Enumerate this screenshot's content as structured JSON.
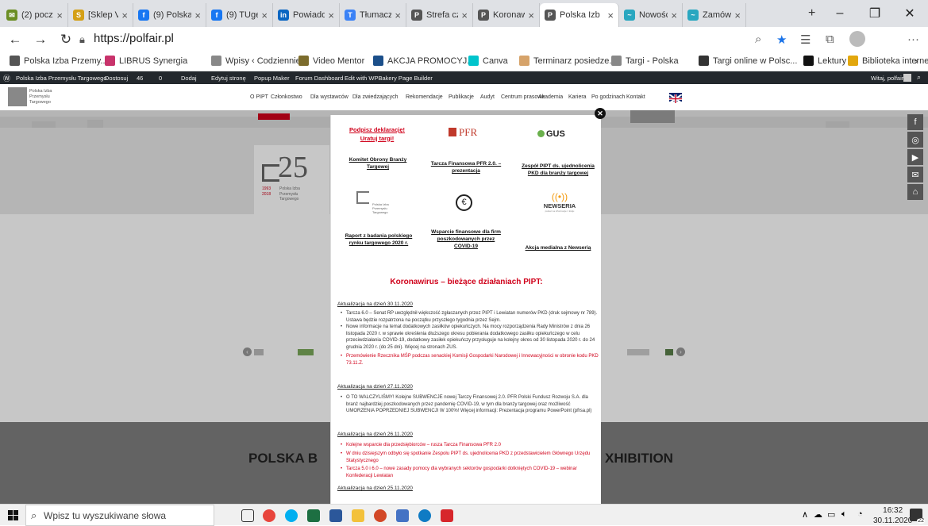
{
  "browser": {
    "tabs": [
      {
        "label": "(2) poczta",
        "color": "#6b8e23",
        "glyph": "✉"
      },
      {
        "label": "[Sklep Va",
        "color": "#d4a017",
        "glyph": "S"
      },
      {
        "label": "(9) Polska",
        "color": "#1877f2",
        "glyph": "f"
      },
      {
        "label": "(9) TUget",
        "color": "#1877f2",
        "glyph": "f"
      },
      {
        "label": "Powiadom",
        "color": "#0a66c2",
        "glyph": "in"
      },
      {
        "label": "Tłumacz G",
        "color": "#3b82f6",
        "glyph": "T"
      },
      {
        "label": "Strefa czł",
        "color": "#555555",
        "glyph": "P"
      },
      {
        "label": "Koronawi",
        "color": "#555555",
        "glyph": "P"
      },
      {
        "label": "Polska Izb",
        "color": "#555555",
        "glyph": "P"
      },
      {
        "label": "Nowości",
        "color": "#2aa7c0",
        "glyph": "~"
      },
      {
        "label": "Zamówie",
        "color": "#2aa7c0",
        "glyph": "~"
      }
    ],
    "new_tab": "+",
    "url": "https://polfair.pl",
    "bookmarks": [
      {
        "label": "Polska Izba Przemy...",
        "color": "#555555"
      },
      {
        "label": "LIBRUS Synergia",
        "color": "#c8336b"
      },
      {
        "label": "Wpisy ‹ Codziennie...",
        "color": "#888888"
      },
      {
        "label": "Video Mentor",
        "color": "#7c6c2c"
      },
      {
        "label": "AKCJA PROMOCYJ...",
        "color": "#1b4f8a"
      },
      {
        "label": "Canva",
        "color": "#00c4cc"
      },
      {
        "label": "Terminarz posiedze...",
        "color": "#d6a36a"
      },
      {
        "label": "Targi - Polska",
        "color": "#888888"
      },
      {
        "label": "Targi online w Polsc...",
        "color": "#333333"
      },
      {
        "label": "Lektury",
        "color": "#111111"
      },
      {
        "label": "Biblioteka interneto...",
        "color": "#e2a70d"
      }
    ]
  },
  "wpbar": {
    "items": [
      "Polska Izba Przemysłu Targowego",
      "Dostosuj",
      "46",
      "0",
      "Dodaj",
      "Edytuj stronę",
      "Popup Maker",
      "Forum Dashboard",
      "Edit with WPBakery Page Builder"
    ],
    "greeting": "Witaj, polfair"
  },
  "site": {
    "logo_text": "Polska Izba Przemysłu Targowego",
    "nav": [
      "O PIPT",
      "Członkostwo",
      "Dla wystawców",
      "Dla zwiedzających",
      "Rekomendacje",
      "Publikacje",
      "Audyt",
      "Centrum prasowe",
      "Akademia",
      "Kariera",
      "Po godzinach",
      "Kontakt"
    ],
    "anniv_number": "25",
    "anniv_years": "1993\n2018",
    "anniv_text": "Polska Izba\nPrzemysłu\nTargowego",
    "lower_title_left": "POLSKA B",
    "lower_title_right": "XHIBITION"
  },
  "modal": {
    "cells": [
      {
        "title": "Podpisz deklarację!",
        "title2": "Uratuj targi!"
      },
      {
        "logo": "PFR"
      },
      {
        "logo": "GUS"
      },
      {
        "title": "Komitet Obrony Branży Targowej"
      },
      {
        "title": "Tarcza Finansowa PFR 2.0. – prezentacja"
      },
      {
        "title": "Zespół PIPT ds. ujednolicenia PKD dla branży targowej"
      },
      {
        "logo_small": "Polska Izba Przemysłu Targowego"
      },
      {
        "logo": "€"
      },
      {
        "logo": "NEWSERIA",
        "tagline": "pulsar na informacje z kraju"
      },
      {
        "title": "Raport z badania polskiego rynku targowego 2020 r."
      },
      {
        "title": "Wsparcie finansowe dla firm poszkodowanych przez COVID-19"
      },
      {
        "title": "Akcja medialna z Newserią"
      }
    ],
    "heading": "Koronawirus – bieżące działaniach PIPT:",
    "updates": [
      {
        "date": "Aktualizacja na dzień 30.11.2020",
        "bullets": [
          {
            "text": "Tarcza 6.0 – Senat RP uwzględnił większość zgłaszanych przez PIPT i Lewiatan numerów PKD (druk sejmowy nr 789). Ustawa będzie rozpatrzona na początku przyszłego tygodnia przez Sejm.",
            "red": false
          },
          {
            "text": "Nowe informacje na temat dodatkowych zasiłków opiekuńczych. Na mocy rozporządzenia Rady Ministrów z dnia 26 listopada 2020 r. w sprawie określenia dłuższego okresu pobierania dodatkowego zasiłku opiekuńczego w celu przeciwdziałania COVID-19, dodatkowy zasiłek opiekuńczy przysługuje na kolejny okres od 30 listopada 2020 r. do 24 grudnia 2020 r. (do 25 dni). Więcej na stronach ZUS.",
            "red": false
          },
          {
            "text": "Przemówienie Rzecznika MŚP podczas senackiej Komisji Gospodarki Narodowej i Innowacyjności w obronie kodu PKD 73.11.Z.",
            "red": true
          }
        ]
      },
      {
        "date": "Aktualizacja na dzień 27.11.2020",
        "bullets": [
          {
            "text": "O TO WALCZYLIŚMY! Kolejne SUBWENCJE nowej Tarczy Finansowej 2.0. PFR Polski Fundusz Rozwoju S.A. dla branż najbardziej poszkodowanych przez pandemię COVID-19, w tym dla branży targowej oraz możliwość UMORZENIA POPRZEDNIEJ SUBWENCJI W 100%! Więcej informacji: Prezentacja programu PowerPoint (pfrsa.pl)",
            "red": false
          }
        ]
      },
      {
        "date": "Aktualizacja na dzień 26.11.2020",
        "bullets": [
          {
            "text": "Kolejne wsparcie dla przedsiębiorców – rusza Tarcza Finansowa PFR 2.0",
            "red": true
          },
          {
            "text": "W dniu dzisiejszym odbyło się spotkanie Zespołu PIPT ds. ujednolicenia PKD z przedstawicielem Głównego Urzędu Statystycznego",
            "red": true
          },
          {
            "text": "Tarcza 5.0 i 6.0 – nowe zasady pomocy dla wybranych sektorów gospodarki dotkniętych COVID-19 – webinar Konfederacji Lewiatan",
            "red": true
          }
        ]
      },
      {
        "date": "Aktualizacja na dzień 25.11.2020",
        "bullets": []
      }
    ]
  },
  "taskbar": {
    "search_placeholder": "Wpisz tu wyszukiwane słowa",
    "time": "16:32",
    "date": "30.11.2020",
    "notif_count": "22"
  },
  "colors": {
    "accent": "#d0021b",
    "wpbar": "#23282d",
    "tabstrip": "#dfe1e5"
  }
}
